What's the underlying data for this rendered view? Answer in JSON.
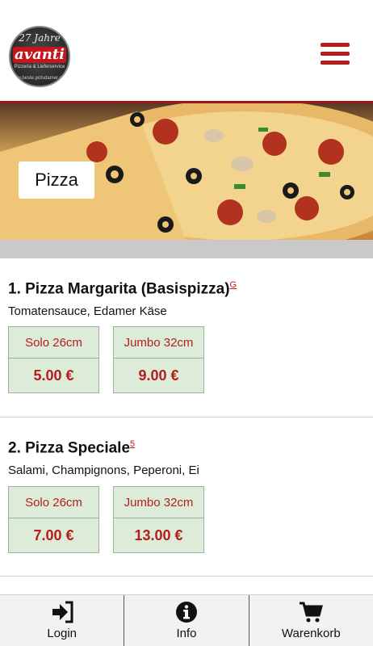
{
  "logo": {
    "years": "27 Jahre",
    "brand": "avanti",
    "tagline": "Pizzeria & Lieferservice",
    "url": "www.beste.potsdamer.pizza"
  },
  "hero": {
    "label": "Pizza"
  },
  "items": [
    {
      "title": "1. Pizza Margarita (Basispizza)",
      "note": "G",
      "description": "Tomatensauce, Edamer Käse",
      "prices": [
        {
          "size": "Solo 26cm",
          "price": "5.00 €"
        },
        {
          "size": "Jumbo 32cm",
          "price": "9.00 €"
        }
      ]
    },
    {
      "title": "2. Pizza Speciale",
      "note": "5",
      "description": "Salami, Champignons, Peperoni, Ei",
      "prices": [
        {
          "size": "Solo 26cm",
          "price": "7.00 €"
        },
        {
          "size": "Jumbo 32cm",
          "price": "13.00 €"
        }
      ]
    }
  ],
  "bottom_nav": [
    {
      "label": "Login",
      "icon": "sign-in-icon"
    },
    {
      "label": "Info",
      "icon": "info-icon"
    },
    {
      "label": "Warenkorb",
      "icon": "cart-icon"
    }
  ],
  "colors": {
    "accent": "#b71c1c",
    "price_box": "#dcecd9",
    "divider_bar": "#c9c9c9"
  }
}
